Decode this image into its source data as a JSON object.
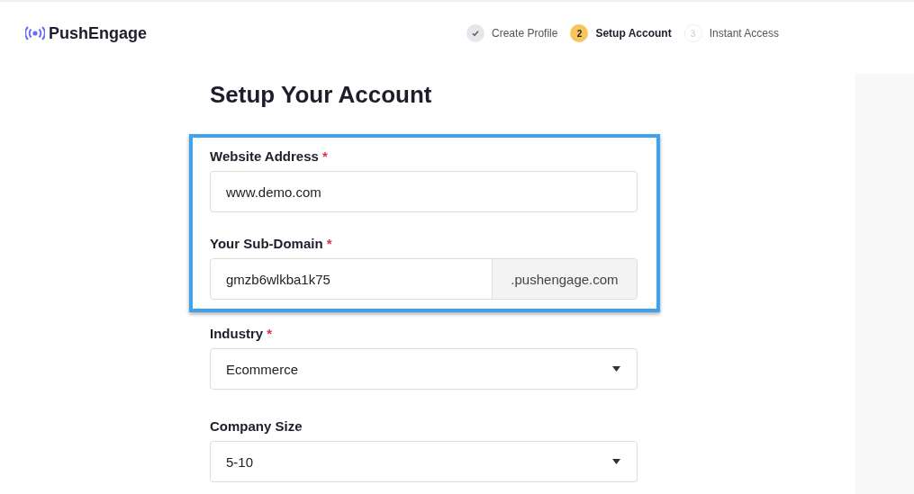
{
  "logo": {
    "text": "PushEngage"
  },
  "steps": [
    {
      "label": "Create Profile",
      "completed": true,
      "selected": false
    },
    {
      "number": "2",
      "label": "Setup Account",
      "completed": false,
      "selected": true
    },
    {
      "number": "3",
      "label": "Instant Access",
      "completed": false,
      "selected": false
    }
  ],
  "form": {
    "title": "Setup Your Account",
    "groups": [
      {
        "highlighted": true,
        "fields": [
          {
            "kind": "input",
            "label": "Website Address",
            "required_mark": "*",
            "value": "www.demo.com"
          },
          {
            "kind": "suffix",
            "label": "Your Sub-Domain",
            "required_mark": "*",
            "value": "gmzb6wlkba1k75",
            "suffix": ".pushengage.com"
          }
        ]
      },
      {
        "highlighted": false,
        "fields": [
          {
            "kind": "select",
            "label": "Industry",
            "required_mark": "*",
            "value": "Ecommerce"
          },
          {
            "kind": "select",
            "label": "Company Size",
            "value": "5-10"
          }
        ]
      }
    ]
  }
}
